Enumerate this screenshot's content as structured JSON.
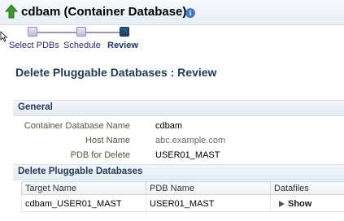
{
  "header": {
    "title": "cdbam (Container Database)",
    "info_glyph": "i"
  },
  "train": {
    "steps": [
      {
        "label": "Select PDBs",
        "state": "visited"
      },
      {
        "label": "Schedule",
        "state": "visited"
      },
      {
        "label": "Review",
        "state": "current"
      }
    ]
  },
  "page_title": "Delete Pluggable Databases : Review",
  "general": {
    "title": "General",
    "fields": [
      {
        "label": "Container Database Name",
        "value": "cdbam"
      },
      {
        "label": "Host Name",
        "value": "abc.example.com"
      },
      {
        "label": "PDB for Delete",
        "value": "USER01_MAST"
      }
    ]
  },
  "pdb_section": {
    "title": "Delete Pluggable Databases",
    "columns": [
      "Target Name",
      "PDB Name",
      "Datafiles"
    ],
    "rows": [
      {
        "target_name": "cdbam_USER01_MAST",
        "pdb_name": "USER01_MAST",
        "datafiles": "Show"
      }
    ]
  },
  "colors": {
    "accent": "#1d3a5a",
    "train_current": "#1b3e66",
    "home_green": "#3c9a2c"
  }
}
